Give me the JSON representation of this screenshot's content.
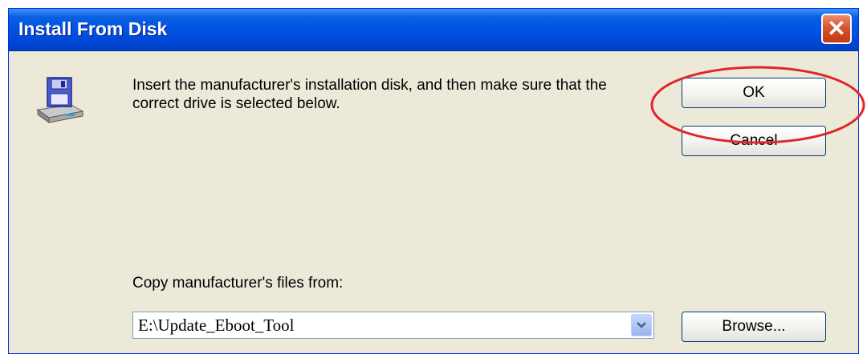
{
  "window": {
    "title": "Install From Disk",
    "close_glyph": "✕"
  },
  "content": {
    "instructions": "Insert the manufacturer's installation disk, and then make sure that the correct drive is selected below.",
    "copy_label": "Copy manufacturer's files from:",
    "path_value": "E:\\Update_Eboot_Tool"
  },
  "buttons": {
    "ok": "OK",
    "cancel": "Cancel",
    "browse": "Browse..."
  },
  "icons": {
    "disk": "floppy-disk-drive-icon",
    "dropdown": "chevron-down-icon",
    "close": "close-icon"
  },
  "annotation": {
    "highlight_color": "#e0262b"
  }
}
